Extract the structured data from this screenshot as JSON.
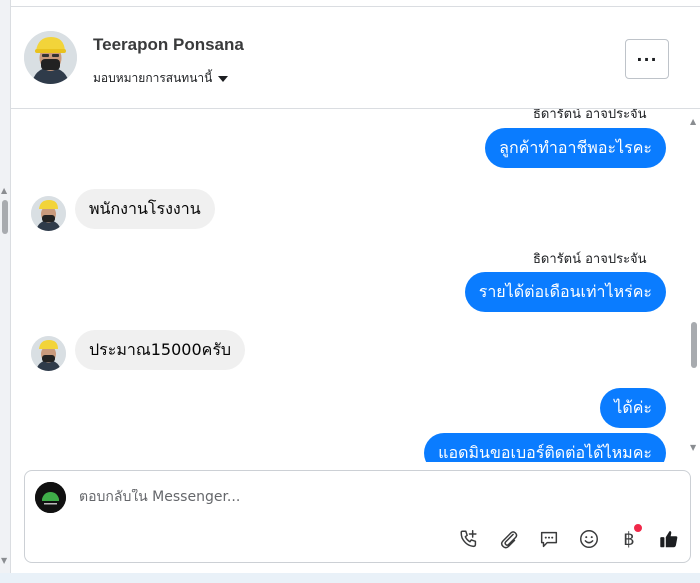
{
  "header": {
    "contact_name": "Teerapon Ponsana",
    "assign_label": "มอบหมายการสนทนานี้",
    "more_label": "···"
  },
  "messages": [
    {
      "direction": "out",
      "sender": "ธิดารัตน์ อาจประจัน",
      "text": "ลูกค้าทำอาชีพอะไรคะ"
    },
    {
      "direction": "in",
      "text": "พนักงานโรงงาน"
    },
    {
      "direction": "out",
      "sender": "ธิดารัตน์ อาจประจัน",
      "text": "รายได้ต่อเดือนเท่าไหร่คะ"
    },
    {
      "direction": "in",
      "text": "ประมาณ15000ครับ"
    },
    {
      "direction": "out",
      "text": "ได้ค่ะ"
    },
    {
      "direction": "out",
      "text": "แอดมินขอเบอร์ติดต่อได้ไหมคะ"
    }
  ],
  "composer": {
    "placeholder": "ตอบกลับใน Messenger...",
    "baht_symbol": "฿"
  },
  "icons": [
    "more-icon",
    "caret-down-icon",
    "call-add-icon",
    "paperclip-icon",
    "saved-reply-icon",
    "emoji-icon",
    "baht-icon",
    "like-icon"
  ],
  "colors": {
    "outgoing_bubble": "#0a7cff",
    "incoming_bubble": "#f0f0f0",
    "notification_dot": "#f02849"
  }
}
